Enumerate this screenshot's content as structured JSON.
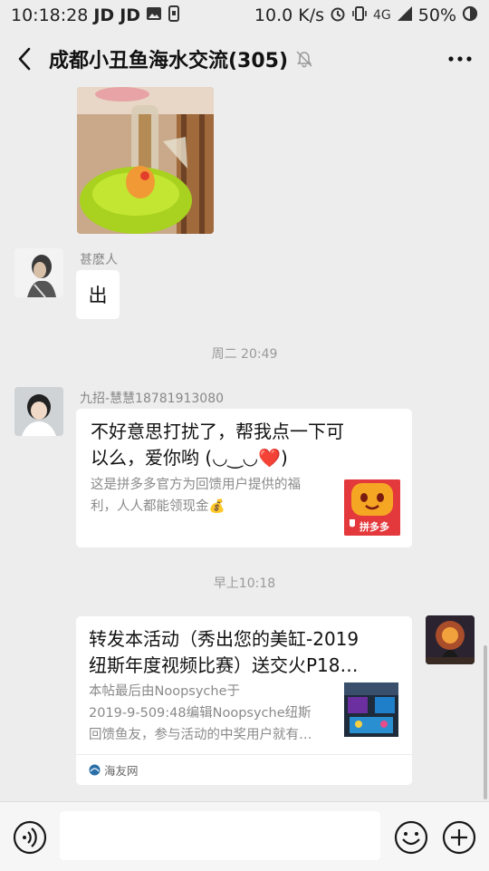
{
  "status_bar": {
    "time": "10:18:28",
    "notif_1": "JD",
    "notif_2": "JD",
    "speed": "10.0 K/s",
    "network": "4G",
    "battery": "50%"
  },
  "header": {
    "title": "成都小丑鱼海水交流(305)"
  },
  "messages": {
    "m1": {
      "sender": "甚麽人",
      "text": "出"
    },
    "time_1": "周二 20:49",
    "m2": {
      "sender": "九招-慧慧18781913080",
      "line1": "不好意思打扰了，帮我点一下可",
      "line2": "以么，爱你哟 (◡‿◡❤️)",
      "desc1": "这是拼多多官方为回馈用户提供的福",
      "desc2": "利，人人都能领现金💰",
      "thumb_label": "拼多多"
    },
    "time_2": "早上10:18",
    "m3": {
      "line1": "转发本活动（秀出您的美缸-2019",
      "line2": "纽斯年度视频比赛）送交火P18…",
      "desc1": "本帖最后由Noopsyche于",
      "desc2": "2019-9-509:48编辑Noopsyche纽斯",
      "desc3": "回馈鱼友，参与活动的中奖用户就有…",
      "source": "海友网"
    }
  },
  "colors": {
    "background": "#ededed",
    "bubble": "#ffffff",
    "pdd_red": "#e4393c"
  }
}
